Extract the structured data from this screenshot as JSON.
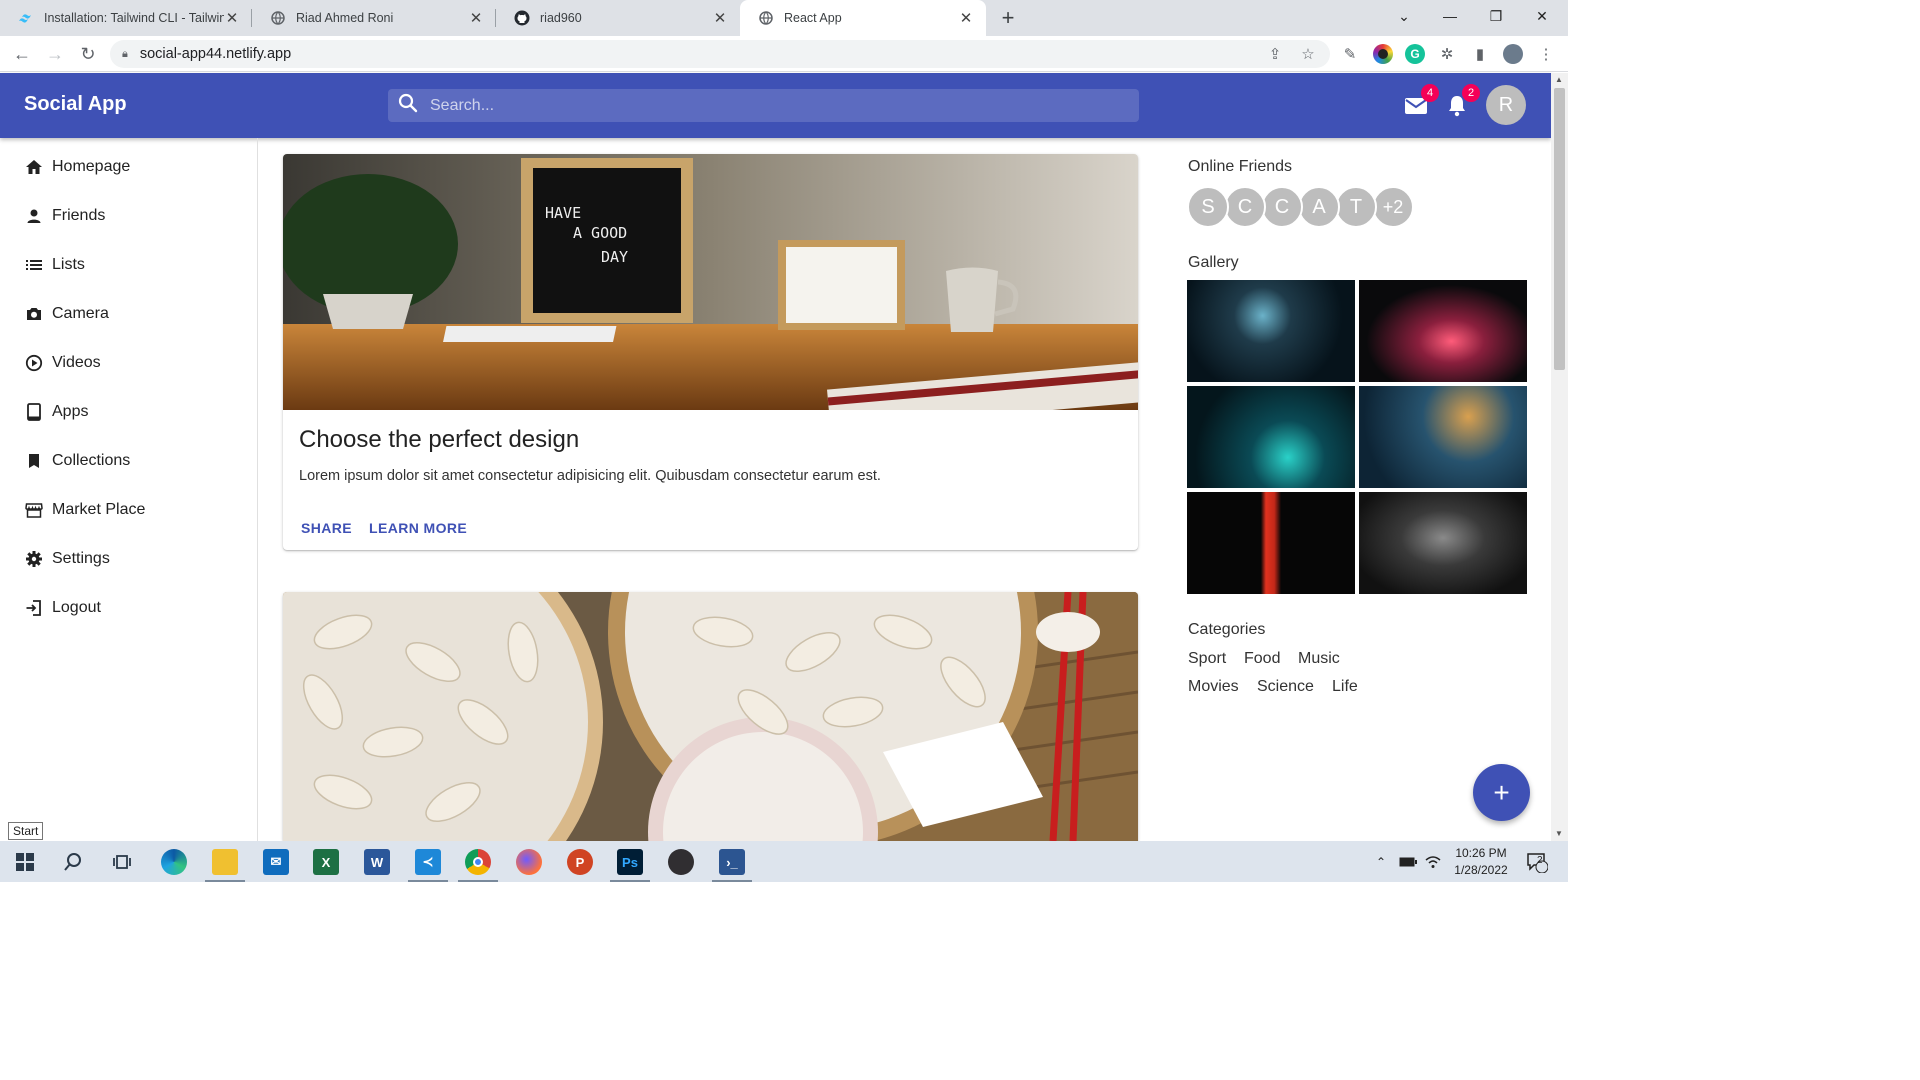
{
  "browser": {
    "tabs": [
      {
        "title": "Installation: Tailwind CLI - Tailwind",
        "icon": "tailwind-icon"
      },
      {
        "title": "Riad Ahmed Roni",
        "icon": "globe-icon"
      },
      {
        "title": "riad960",
        "icon": "github-icon"
      },
      {
        "title": "React App",
        "icon": "globe-icon",
        "active": true
      }
    ],
    "url": "social-app44.netlify.app"
  },
  "appbar": {
    "brand": "Social App",
    "search_placeholder": "Search...",
    "mail_badge": "4",
    "notif_badge": "2",
    "avatar_letter": "R",
    "color": "#3f51b5"
  },
  "sidebar": {
    "items": [
      {
        "label": "Homepage",
        "icon": "home-icon"
      },
      {
        "label": "Friends",
        "icon": "person-icon"
      },
      {
        "label": "Lists",
        "icon": "list-icon"
      },
      {
        "label": "Camera",
        "icon": "camera-icon"
      },
      {
        "label": "Videos",
        "icon": "play-circle-icon"
      },
      {
        "label": "Apps",
        "icon": "tablet-icon"
      },
      {
        "label": "Collections",
        "icon": "bookmark-icon"
      },
      {
        "label": "Market Place",
        "icon": "storefront-icon"
      },
      {
        "label": "Settings",
        "icon": "gear-icon"
      },
      {
        "label": "Logout",
        "icon": "logout-icon"
      }
    ],
    "start_tooltip": "Start"
  },
  "feed": {
    "posts": [
      {
        "title": "Choose the perfect design",
        "body": "Lorem ipsum dolor sit amet consectetur adipisicing elit. Quibusdam consectetur earum est.",
        "share": "SHARE",
        "learn_more": "LEARN MORE",
        "board_text": [
          "HAVE",
          "A GOOD",
          "DAY"
        ]
      }
    ]
  },
  "rightbar": {
    "online_title": "Online Friends",
    "online_friends": [
      "S",
      "C",
      "C",
      "A",
      "T",
      "+2"
    ],
    "gallery_title": "Gallery",
    "categories_title": "Categories",
    "categories": [
      "Sport",
      "Food",
      "Music",
      "Movies",
      "Science",
      "Life"
    ]
  },
  "fab": {
    "label": "+"
  },
  "taskbar": {
    "time": "10:26 PM",
    "date": "1/28/2022",
    "notif_count": "2",
    "apps": [
      "windows-start-icon",
      "search-icon",
      "task-view-icon",
      "edge-icon",
      "file-explorer-icon",
      "mail-icon",
      "excel-icon",
      "word-icon",
      "vscode-icon",
      "chrome-icon",
      "firefox-icon",
      "powerpoint-icon",
      "photoshop-icon",
      "obs-icon",
      "powershell-icon"
    ],
    "labels": {
      "excel": "X",
      "word": "W",
      "powerpoint": "P",
      "photoshop": "Ps"
    }
  }
}
